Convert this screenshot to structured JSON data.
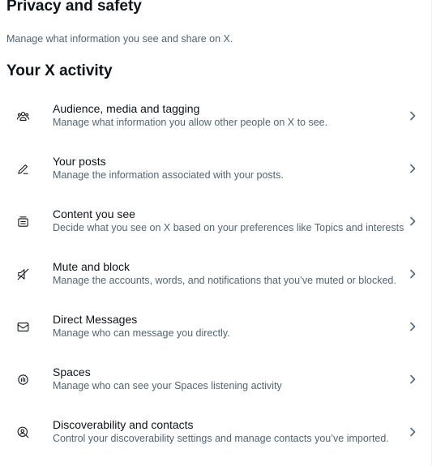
{
  "header": {
    "title": "Privacy and safety",
    "subtitle": "Manage what information you see and share on X."
  },
  "section": {
    "heading": "Your X activity"
  },
  "items": [
    {
      "title": "Audience, media and tagging",
      "description": "Manage what information you allow other people on X to see.",
      "icon": "people-icon"
    },
    {
      "title": "Your posts",
      "description": "Manage the information associated with your posts.",
      "icon": "pencil-icon"
    },
    {
      "title": "Content you see",
      "description": "Decide what you see on X based on your preferences like Topics and interests",
      "icon": "content-icon"
    },
    {
      "title": "Mute and block",
      "description": "Manage the accounts, words, and notifications that you’ve muted or blocked.",
      "icon": "mute-icon"
    },
    {
      "title": "Direct Messages",
      "description": "Manage who can message you directly.",
      "icon": "envelope-icon"
    },
    {
      "title": "Spaces",
      "description": "Manage who can see your Spaces listening activity",
      "icon": "spaces-icon"
    },
    {
      "title": "Discoverability and contacts",
      "description": "Control your discoverability settings and manage contacts you’ve imported.",
      "icon": "discover-icon"
    }
  ],
  "colors": {
    "text_primary": "#0f1419",
    "text_secondary": "#536471",
    "divider": "#eff3f4"
  }
}
